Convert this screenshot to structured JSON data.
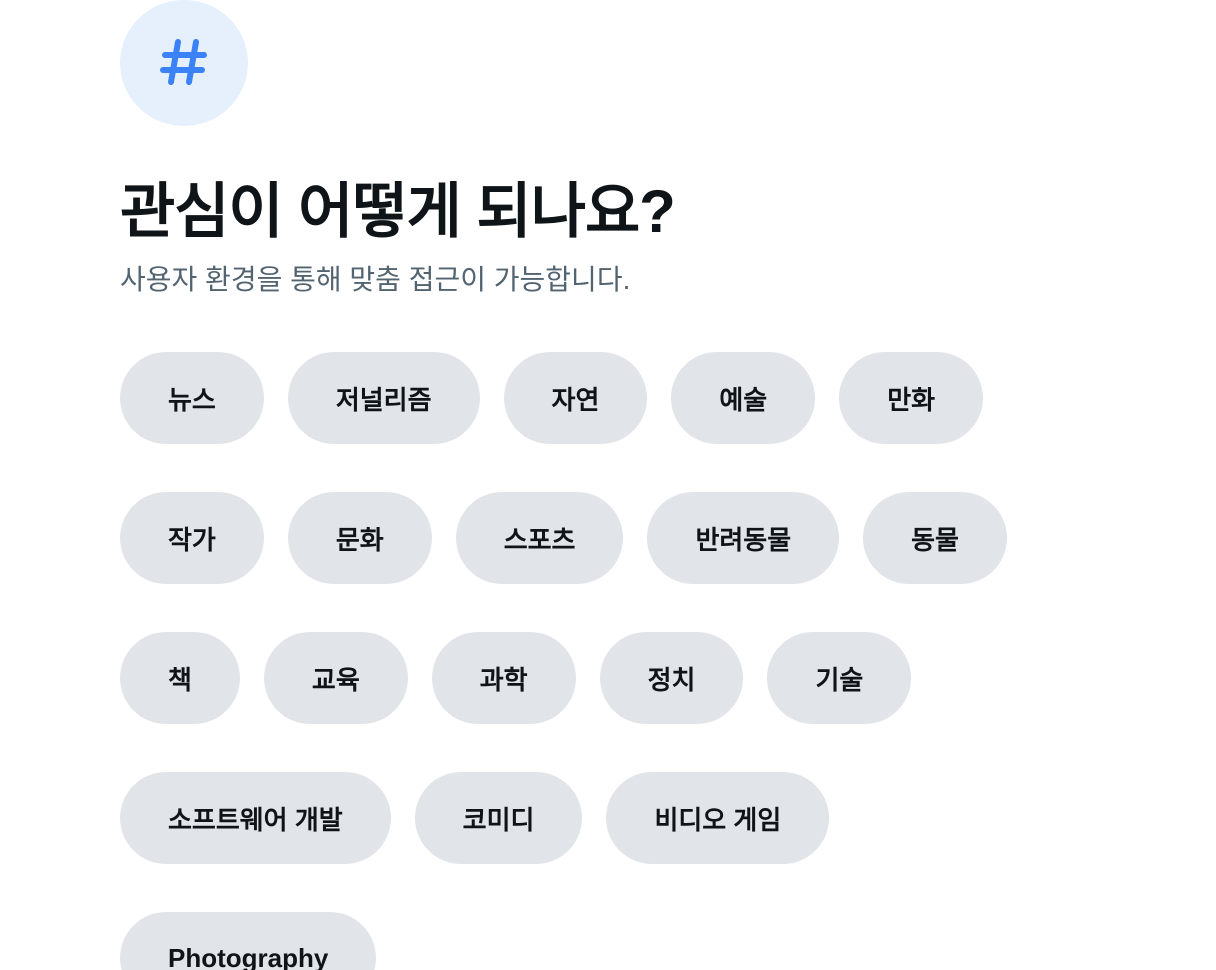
{
  "header": {
    "icon": "hashtag-icon",
    "accent_color": "#3b82f6",
    "icon_bg_color": "#e5f0fc",
    "title": "관심이 어떻게 되나요?",
    "subtitle": "사용자 환경을 통해 맞춤 접근이 가능합니다."
  },
  "topics": [
    [
      "뉴스",
      "저널리즘",
      "자연",
      "예술",
      "만화"
    ],
    [
      "작가",
      "문화",
      "스포츠",
      "반려동물",
      "동물"
    ],
    [
      "책",
      "교육",
      "과학",
      "정치",
      "기술"
    ],
    [
      "소프트웨어 개발",
      "코미디",
      "비디오 게임"
    ],
    [
      "Photography"
    ]
  ]
}
